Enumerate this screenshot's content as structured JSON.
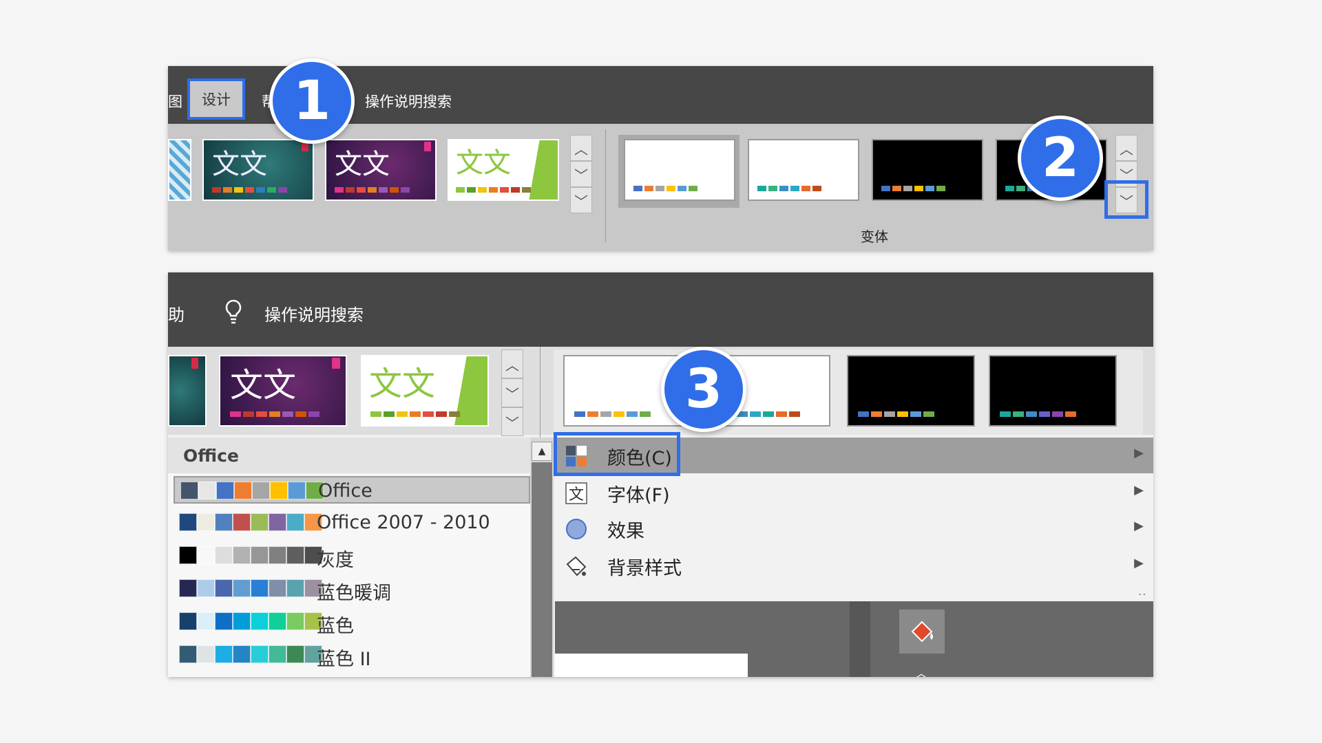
{
  "panel1": {
    "tab_left_fragment": "图",
    "tab_design": "设计",
    "tab_help_fragment": "帮",
    "search_label": "操作说明搜索",
    "theme_glyph": "文文",
    "variants_group_label": "变体"
  },
  "panel2": {
    "tab_help_fragment": "助",
    "search_label": "操作说明搜索",
    "theme_glyph": "文文",
    "palette_header": "Office",
    "palettes": [
      {
        "label": "Office",
        "colors": [
          "#44546a",
          "#e7e6e6",
          "#4472c4",
          "#ed7d31",
          "#a5a5a5",
          "#ffc000",
          "#5b9bd5",
          "#70ad47"
        ]
      },
      {
        "label": "Office 2007 - 2010",
        "colors": [
          "#1f497d",
          "#eeece1",
          "#4f81bd",
          "#c0504d",
          "#9bbb59",
          "#8064a2",
          "#4bacc6",
          "#f79646"
        ]
      },
      {
        "label": "灰度",
        "colors": [
          "#000000",
          "#f8f8f8",
          "#dddddd",
          "#b2b2b2",
          "#969696",
          "#808080",
          "#5f5f5f",
          "#4d4d4d"
        ]
      },
      {
        "label": "蓝色暖调",
        "colors": [
          "#242852",
          "#acccea",
          "#4a66ac",
          "#629dd1",
          "#297fd5",
          "#7f8fa9",
          "#5aa2ae",
          "#9d90a0"
        ]
      },
      {
        "label": "蓝色",
        "colors": [
          "#17406d",
          "#dbeff9",
          "#0f6fc6",
          "#009dd9",
          "#0bd0d9",
          "#10cf9b",
          "#7cca62",
          "#a5c249"
        ]
      },
      {
        "label": "蓝色 II",
        "colors": [
          "#335b74",
          "#dfe3e5",
          "#1cade4",
          "#2683c6",
          "#27ced7",
          "#42ba97",
          "#3e8853",
          "#62a39f"
        ]
      }
    ],
    "menu": [
      {
        "label": "颜色(C)",
        "icon": "color-palette-icon"
      },
      {
        "label": "字体(F)",
        "icon": "font-icon"
      },
      {
        "label": "效果",
        "icon": "effects-icon"
      },
      {
        "label": "背景样式",
        "icon": "background-style-icon"
      }
    ]
  },
  "steps": [
    "1",
    "2",
    "3"
  ],
  "colors": {
    "highlight": "#2f6ee8",
    "ribbon_dark": "#474747"
  }
}
